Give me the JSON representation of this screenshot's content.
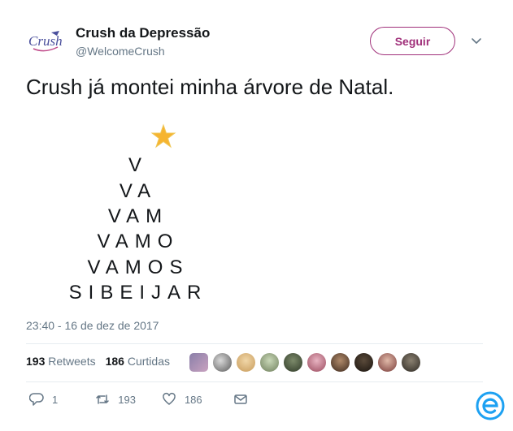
{
  "header": {
    "display_name": "Crush da Depressão",
    "handle": "@WelcomeCrush",
    "follow_label": "Seguir",
    "avatar_icon": "crush-logo-icon"
  },
  "tweet": {
    "text": "Crush já montei minha árvore de Natal.",
    "tree_star_icon": "star-icon",
    "tree_lines": [
      "V",
      "VA",
      "VAM",
      "VAMO",
      "VAMOS",
      "SIBEIJAR"
    ],
    "timestamp": "23:40 - 16 de dez de 2017"
  },
  "stats": {
    "retweets_count": "193",
    "retweets_label": "Retweets",
    "likes_count": "186",
    "likes_label": "Curtidas"
  },
  "actions": {
    "reply_count": "1",
    "retweet_count": "193",
    "like_count": "186"
  },
  "colors": {
    "accent": "#a0307a",
    "text": "#14171a",
    "muted": "#657786",
    "divider": "#e6ecf0",
    "brand": "#1da1f2"
  }
}
